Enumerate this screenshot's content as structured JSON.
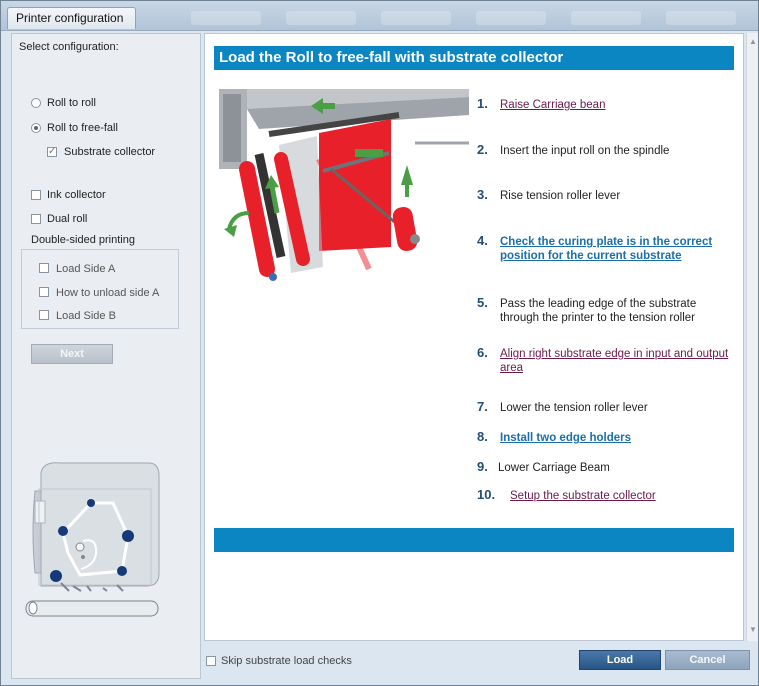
{
  "window": {
    "title": "Printer configuration"
  },
  "left": {
    "select_label": "Select configuration:",
    "options": [
      {
        "label": "Roll to roll",
        "checked": false
      },
      {
        "label": "Roll to free-fall",
        "checked": true
      }
    ],
    "substrate_collector": {
      "label": "Substrate collector",
      "checked": true
    },
    "ink_collector": {
      "label": "Ink collector",
      "checked": false
    },
    "dual_roll": {
      "label": "Dual roll",
      "checked": false
    },
    "double_sided_label": "Double-sided printing",
    "double_sided_items": [
      {
        "label": "Load Side A",
        "checked": false
      },
      {
        "label": "How to unload side A",
        "checked": false
      },
      {
        "label": "Load Side B",
        "checked": false
      }
    ],
    "next_label": "Next"
  },
  "main": {
    "header": "Load the Roll to free-fall with substrate collector",
    "steps": [
      {
        "num": "1.",
        "text": "Raise Carriage bean"
      },
      {
        "num": "2.",
        "text": "Insert the input roll on the spindle"
      },
      {
        "num": "3.",
        "text": "Rise tension roller lever"
      },
      {
        "num": "4.",
        "text": "Check the curing plate is in the correct position for the current substrate"
      },
      {
        "num": "5.",
        "text": "Pass the leading edge of the substrate through the printer to the tension roller"
      },
      {
        "num": "6.",
        "text": "Align right substrate edge in input and output area"
      },
      {
        "num": "7.",
        "text": "Lower the tension roller lever"
      },
      {
        "num": "8.",
        "text": "Install two edge holders"
      },
      {
        "num": "9.",
        "text": "Lower Carriage Beam"
      },
      {
        "num": "10.",
        "text": "Setup the substrate collector"
      }
    ]
  },
  "bottom": {
    "skip_label": "Skip substrate load checks",
    "load_label": "Load",
    "cancel_label": "Cancel"
  },
  "colors": {
    "accent_blue": "#0b86c3",
    "link_purple": "#6b1a4d",
    "link_blue": "#1b6fa9",
    "roller_red": "#e8202a"
  }
}
